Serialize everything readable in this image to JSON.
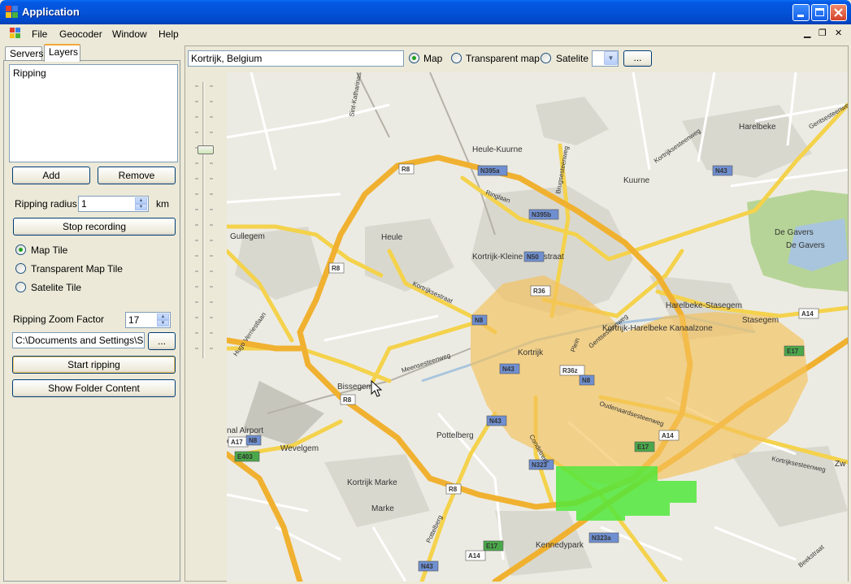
{
  "window": {
    "title": "Application"
  },
  "menu": {
    "items": [
      "File",
      "Geocoder",
      "Window",
      "Help"
    ]
  },
  "left": {
    "tabs": [
      "Servers",
      "Layers"
    ],
    "active_tab": "Layers",
    "layers_list": [
      "Ripping"
    ],
    "add_label": "Add",
    "remove_label": "Remove",
    "radius_label": "Ripping radius",
    "radius_value": "1",
    "radius_unit": "km",
    "stop_label": "Stop recording",
    "tile_options": [
      "Map Tile",
      "Transparent Map Tile",
      "Satelite Tile"
    ],
    "tile_selected": "Map Tile",
    "zoom_label": "Ripping Zoom Factor",
    "zoom_value": "17",
    "folder_path": "C:\\Documents and Settings\\SD",
    "browse_label": "...",
    "start_label": "Start ripping",
    "show_folder_label": "Show Folder Content"
  },
  "toolbar": {
    "location": "Kortrijk, Belgium",
    "map_types": [
      "Map",
      "Transparent map",
      "Satelite"
    ],
    "map_type_selected": "Map",
    "ellipsis_label": "..."
  },
  "map": {
    "places": [
      "Heule-Kuurne",
      "Kuurne",
      "Harelbeke",
      "Gullegem",
      "Heule",
      "De Gavers",
      "De Gavers",
      "Kortrijk-Kleine Ieperstraat",
      "Harelbeke-Stasegem",
      "Stasegem",
      "Kortrijk",
      "Kortrijk-Harelbeke Kanaalzone",
      "Bissegem",
      "nal Airport",
      "evelgem",
      "Wevelgem",
      "Pottelberg",
      "Kortrijk Marke",
      "Marke",
      "Kennedypark",
      "Zw"
    ],
    "roads": [
      "R8",
      "N395a",
      "N395b",
      "N43",
      "N50",
      "R36",
      "N8",
      "N43",
      "R36z",
      "N8",
      "N43",
      "N323",
      "N323a",
      "A14",
      "E17",
      "A14",
      "E17",
      "A17",
      "N8",
      "E403",
      "E17",
      "A14",
      "N43",
      "R8",
      "R8",
      "R8"
    ],
    "streets": [
      "Ringlaan",
      "Brugsesteenweg",
      "Kortrijksesteenweg",
      "Kortrijksestraat",
      "Hugo Verriestlaan",
      "Gentsesteenweg",
      "Meensesteenweg",
      "Oudenaardsesteenweg",
      "Condetreef",
      "Pottelberg",
      "Kortrijksesteenweg",
      "Beekstraat",
      "Sint-Katharinast",
      "Plein",
      "Gentsesteenweg"
    ],
    "overlay_colors": {
      "ripping_area": "#f5c15a",
      "ripped_tiles": "#52e83c"
    }
  }
}
